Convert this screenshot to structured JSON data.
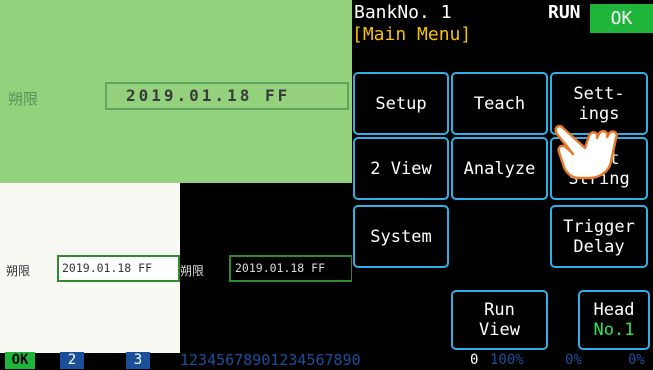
{
  "camera": {
    "green_label": "朔限",
    "green_code": "2019.01.18 FF",
    "light_label": "朔限",
    "light_code": "2019.01.18 FF",
    "dark_label": "朔限",
    "dark_code": "2019.01.18 FF"
  },
  "header": {
    "bank": "BankNo. 1",
    "menu_title": "[Main Menu]",
    "run": "RUN",
    "ok": "OK"
  },
  "buttons": {
    "setup": "Setup",
    "teach": "Teach",
    "settings_l1": "Sett-",
    "settings_l2": "ings",
    "two_view": "2 View",
    "analyze": "Analyze",
    "edit_l1": "Edit",
    "edit_l2": "String",
    "system": "System",
    "trigger_l1": "Trigger",
    "trigger_l2": "Delay",
    "run_view_l1": "Run",
    "run_view_l2": "View",
    "head_l1": "Head",
    "head_l2": "No.1"
  },
  "status_bar": {
    "ok": "OK",
    "two": "2",
    "three": "3",
    "digits": "12345678901234567890",
    "zero": "0",
    "pct1": "100%",
    "pct2": "0%",
    "pct3": "0%"
  },
  "colors": {
    "accent_border": "#2fb0e6",
    "ok_green": "#1fb53b",
    "title_yellow": "#f6c200"
  },
  "icons": {
    "cursor": "hand-pointer-icon"
  }
}
